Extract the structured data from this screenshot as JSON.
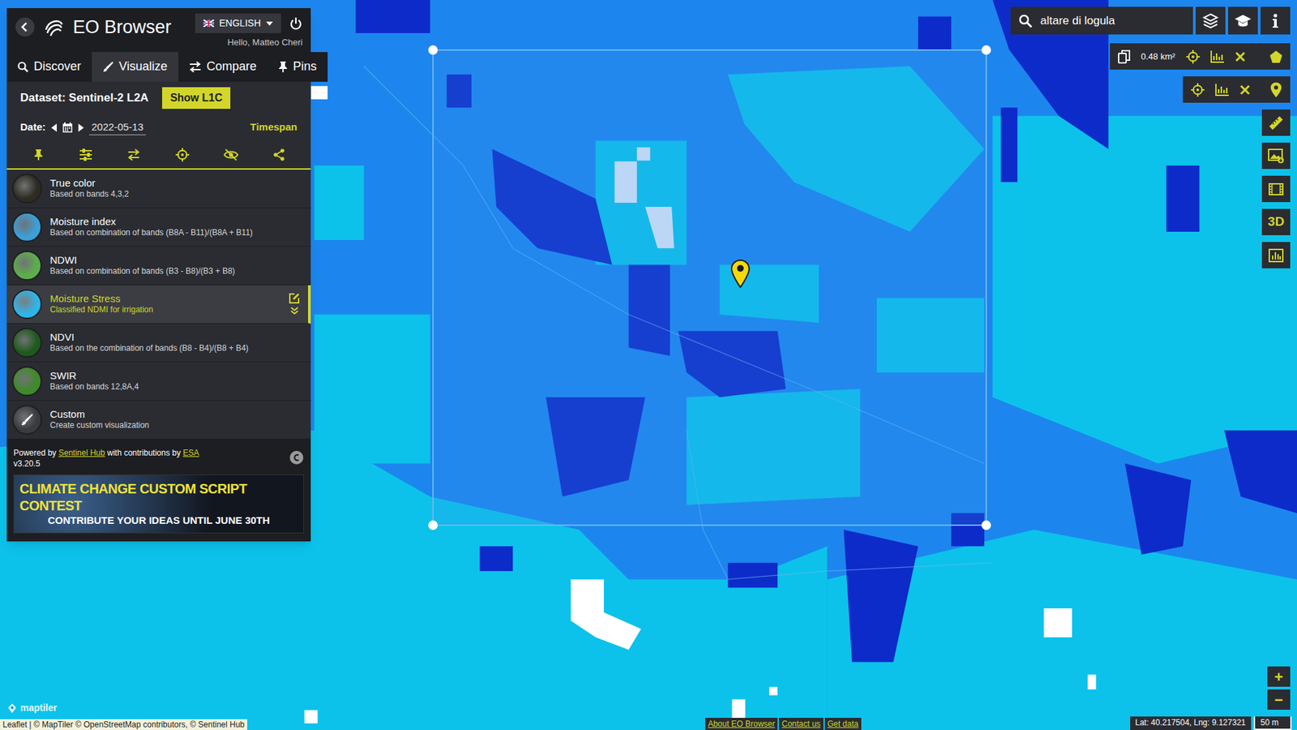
{
  "app": {
    "title": "EO Browser",
    "language": "ENGLISH",
    "greeting": "Hello, Matteo Cheri"
  },
  "tabs": [
    {
      "label": "Discover",
      "selected": false
    },
    {
      "label": "Visualize",
      "selected": true
    },
    {
      "label": "Compare",
      "selected": false
    },
    {
      "label": "Pins",
      "selected": false
    }
  ],
  "dataset": {
    "label": "Dataset: Sentinel-2 L2A",
    "button": "Show L1C"
  },
  "date": {
    "label": "Date:",
    "value": "2022-05-13",
    "timespan": "Timespan"
  },
  "layers": [
    {
      "name": "True color",
      "description": "Based on bands 4,3,2",
      "selected": false,
      "color": "#2e2c22"
    },
    {
      "name": "Moisture index",
      "description": "Based on combination of bands (B8A - B11)/(B8A + B11)",
      "selected": false,
      "color": "#3aa0d8"
    },
    {
      "name": "NDWI",
      "description": "Based on combination of bands (B3 - B8)/(B3 + B8)",
      "selected": false,
      "color": "#5cae4c"
    },
    {
      "name": "Moisture Stress",
      "description": "Classified NDMI for irrigation",
      "selected": true,
      "color": "#2fb5e8"
    },
    {
      "name": "NDVI",
      "description": "Based on the combination of bands (B8 - B4)/(B8 + B4)",
      "selected": false,
      "color": "#1f5a1c"
    },
    {
      "name": "SWIR",
      "description": "Based on bands 12,8A,4",
      "selected": false,
      "color": "#3f8a2a"
    },
    {
      "name": "Custom",
      "description": "Create custom visualization",
      "selected": false,
      "color": "#3a3b3f"
    }
  ],
  "footer": {
    "powered": "Powered by ",
    "sentinel_hub": "Sentinel Hub",
    "with": " with contributions by ",
    "esa": "ESA",
    "version": "v3.20.5"
  },
  "banner": {
    "line1": "CLIMATE CHANGE CUSTOM SCRIPT CONTEST",
    "line2": "CONTRIBUTE YOUR IDEAS UNTIL JUNE 30TH"
  },
  "search": {
    "value": "altare di logula"
  },
  "aoi": {
    "area": "0.48 km²"
  },
  "tools": {
    "three_d": "3D"
  },
  "map": {
    "attribution": "Leaflet | © MapTiler © OpenStreetMap contributors, © Sentinel Hub",
    "logo": "maptiler",
    "links": [
      "About EO Browser",
      "Contact us",
      "Get data"
    ],
    "coords": "Lat: 40.217504, Lng: 9.127321",
    "scale": "50 m",
    "zoom_in": "+",
    "zoom_out": "−"
  }
}
